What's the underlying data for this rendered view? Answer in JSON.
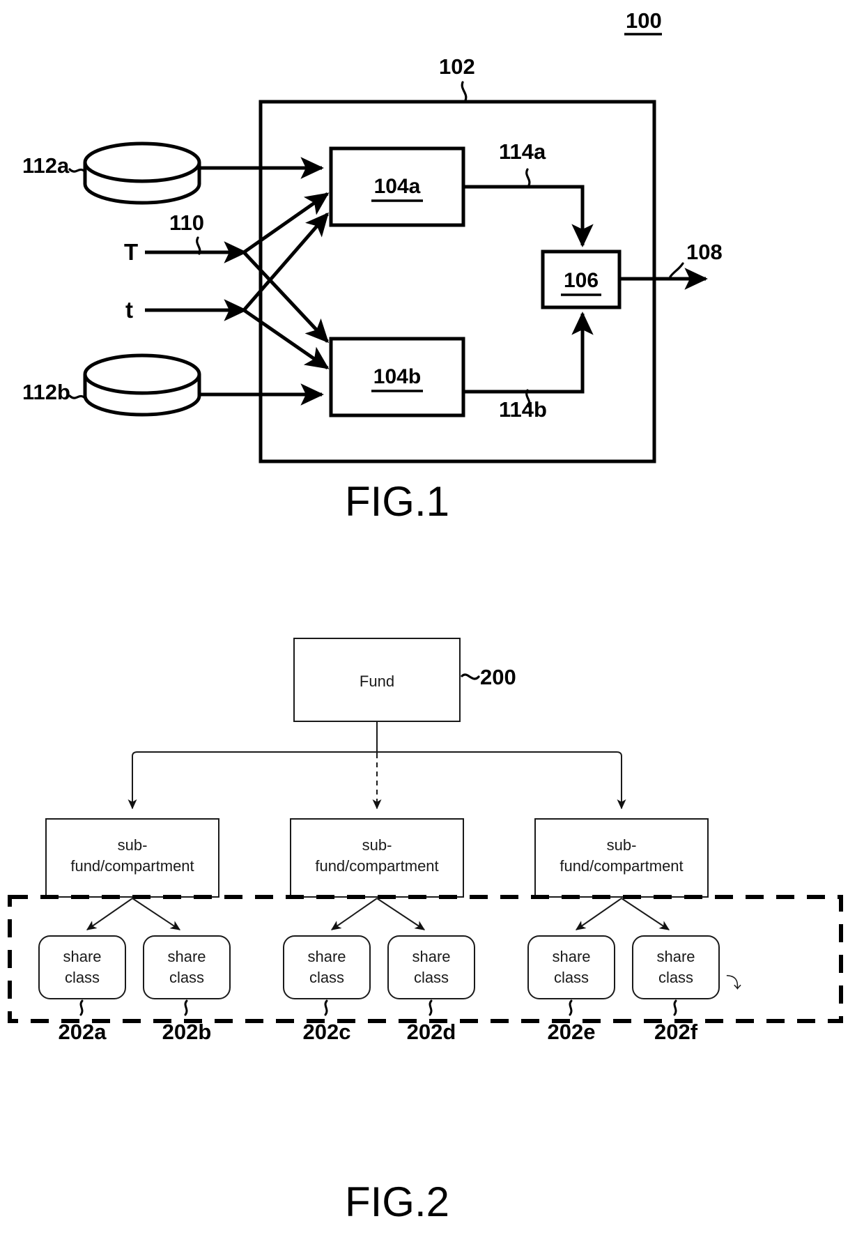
{
  "document": {
    "type": "patent-drawing-sheet",
    "figures": [
      "FIG.1",
      "FIG.2"
    ]
  },
  "fig1": {
    "caption": "FIG.1",
    "system_ref": "100",
    "container_ref": "102",
    "blocks": [
      {
        "label": "104a",
        "ref": "104a"
      },
      {
        "label": "104b",
        "ref": "104b"
      },
      {
        "label": "106",
        "ref": "106"
      }
    ],
    "databases": [
      {
        "ref": "112a"
      },
      {
        "ref": "112b"
      }
    ],
    "inputs": [
      {
        "label": "T"
      },
      {
        "label": "t"
      }
    ],
    "input_bundle_ref": "110",
    "intermediate_refs": [
      "114a",
      "114b"
    ],
    "output_ref": "108"
  },
  "fig2": {
    "caption": "FIG.2",
    "root": {
      "label": "Fund",
      "ref": "200"
    },
    "level2_label": "sub-\nfund/compartment",
    "level2_line1": "sub-",
    "level2_line2": "fund/compartment",
    "subfunds": [
      {
        "label_line1": "sub-",
        "label_line2": "fund/compartment"
      },
      {
        "label_line1": "sub-",
        "label_line2": "fund/compartment"
      },
      {
        "label_line1": "sub-",
        "label_line2": "fund/compartment"
      }
    ],
    "share_class_line1": "share",
    "share_class_line2": "class",
    "share_classes": [
      {
        "label_line1": "share",
        "label_line2": "class",
        "ref": "202a"
      },
      {
        "label_line1": "share",
        "label_line2": "class",
        "ref": "202b"
      },
      {
        "label_line1": "share",
        "label_line2": "class",
        "ref": "202c"
      },
      {
        "label_line1": "share",
        "label_line2": "class",
        "ref": "202d"
      },
      {
        "label_line1": "share",
        "label_line2": "class",
        "ref": "202e"
      },
      {
        "label_line1": "share",
        "label_line2": "class",
        "ref": "202f"
      }
    ],
    "grouping_marker": "⤵"
  },
  "colors": {
    "ink": "#000000",
    "light_ink": "#1a1a1a",
    "paper": "#ffffff"
  }
}
